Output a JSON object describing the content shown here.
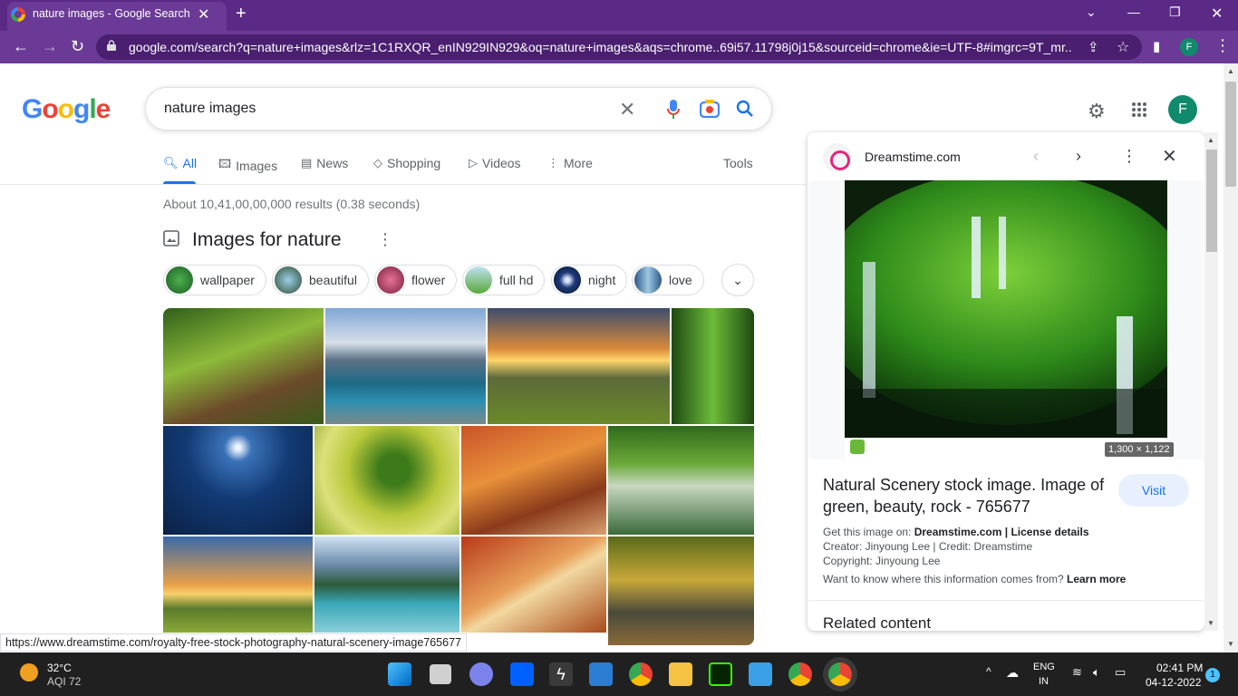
{
  "browser": {
    "tab_title": "nature images - Google Search",
    "url": "google.com/search?q=nature+images&rlz=1C1RXQR_enIN929IN929&oq=nature+images&aqs=chrome..69i57.11798j0j15&sourceid=chrome&ie=UTF-8#imgrc=9T_mr...",
    "profile_initial": "F",
    "status_url": "https://www.dreamstime.com/royalty-free-stock-photography-natural-scenery-image765677"
  },
  "google": {
    "logo_letters": [
      "G",
      "o",
      "o",
      "g",
      "l",
      "e"
    ],
    "search_query": "nature images",
    "avatar_initial": "F",
    "tabs": [
      {
        "label": "All",
        "icon": "search-icon"
      },
      {
        "label": "Images",
        "icon": "image-icon"
      },
      {
        "label": "News",
        "icon": "news-icon"
      },
      {
        "label": "Shopping",
        "icon": "tag-icon"
      },
      {
        "label": "Videos",
        "icon": "play-icon"
      },
      {
        "label": "More",
        "icon": "kebab-icon"
      }
    ],
    "tools_label": "Tools",
    "results_count": "About 10,41,00,00,000 results (0.38 seconds)",
    "images_heading": "Images for nature",
    "chips": [
      "wallpaper",
      "beautiful",
      "flower",
      "full hd",
      "night",
      "love"
    ]
  },
  "panel": {
    "source": "Dreamstime.com",
    "dimensions": "1,300 × 1,122",
    "caption": "Natural Scenery stock image. Image of green, beauty, rock - 765677",
    "visit_label": "Visit",
    "get_image_prefix": "Get this image on: ",
    "get_image_source": "Dreamstime.com",
    "license_sep": " | ",
    "license_label": "License details",
    "creator": "Creator: Jinyoung Lee | Credit: Dreamstime",
    "copyright": "Copyright: Jinyoung Lee",
    "info_question": "Want to know where this information comes from? ",
    "learn_more": "Learn more",
    "related": "Related content"
  },
  "taskbar": {
    "temperature": "32°C",
    "aqi": "AQI 72",
    "lang_line1": "ENG",
    "lang_line2": "IN",
    "time": "02:41 PM",
    "date": "04-12-2022",
    "notification_count": "1"
  },
  "colors": {
    "accent": "#1a73e8",
    "chrome_frame": "#5b2a86"
  }
}
